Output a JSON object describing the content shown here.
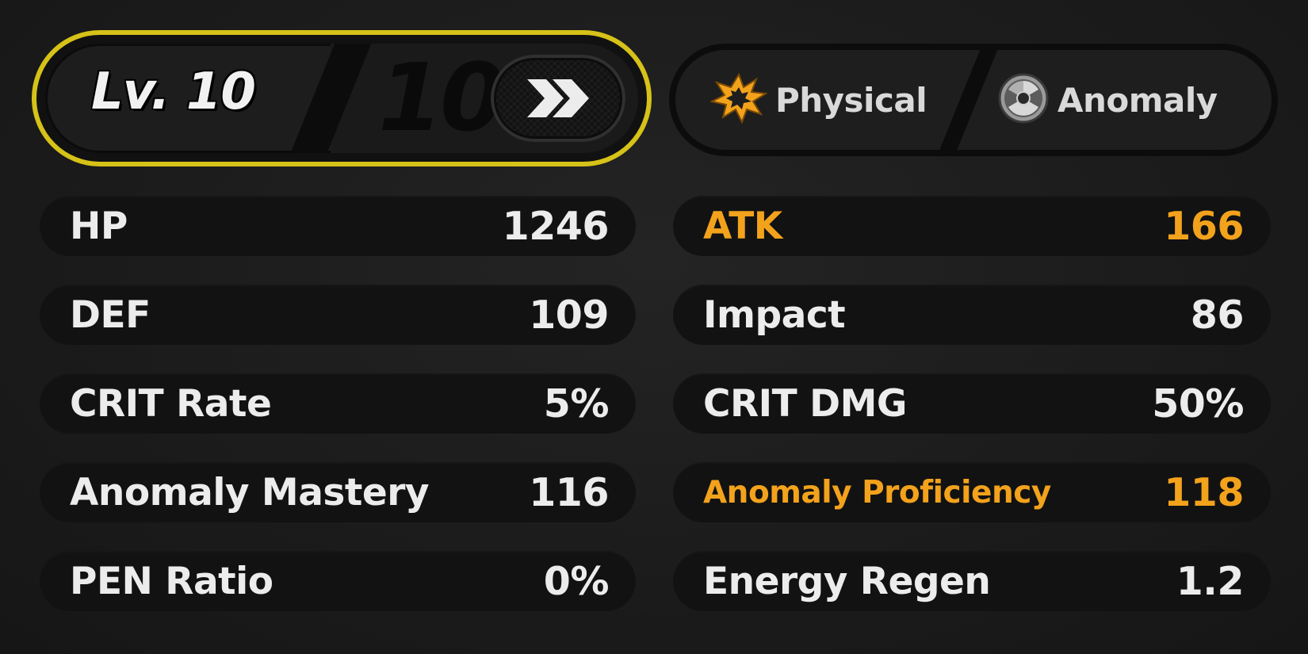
{
  "level": {
    "current_label": "Lv. 10",
    "max_level": "10",
    "advance_icon": "double-chevron-right-icon",
    "border_color": "#d6c218"
  },
  "attributes": {
    "physical": {
      "label": "Physical",
      "icon": "physical-burst-icon",
      "icon_color": "#f3a21c"
    },
    "anomaly": {
      "label": "Anomaly",
      "icon": "anomaly-hazard-icon"
    }
  },
  "accent_color": "#f3a21c",
  "stats": {
    "left": [
      {
        "label": "HP",
        "value": "1246",
        "highlight": false
      },
      {
        "label": "DEF",
        "value": "109",
        "highlight": false
      },
      {
        "label": "CRIT Rate",
        "value": "5%",
        "highlight": false
      },
      {
        "label": "Anomaly Mastery",
        "value": "116",
        "highlight": false
      },
      {
        "label": "PEN Ratio",
        "value": "0%",
        "highlight": false
      }
    ],
    "right": [
      {
        "label": "ATK",
        "value": "166",
        "highlight": true
      },
      {
        "label": "Impact",
        "value": "86",
        "highlight": false
      },
      {
        "label": "CRIT DMG",
        "value": "50%",
        "highlight": false
      },
      {
        "label": "Anomaly Proficiency",
        "value": "118",
        "highlight": true
      },
      {
        "label": "Energy Regen",
        "value": "1.2",
        "highlight": false
      }
    ]
  }
}
